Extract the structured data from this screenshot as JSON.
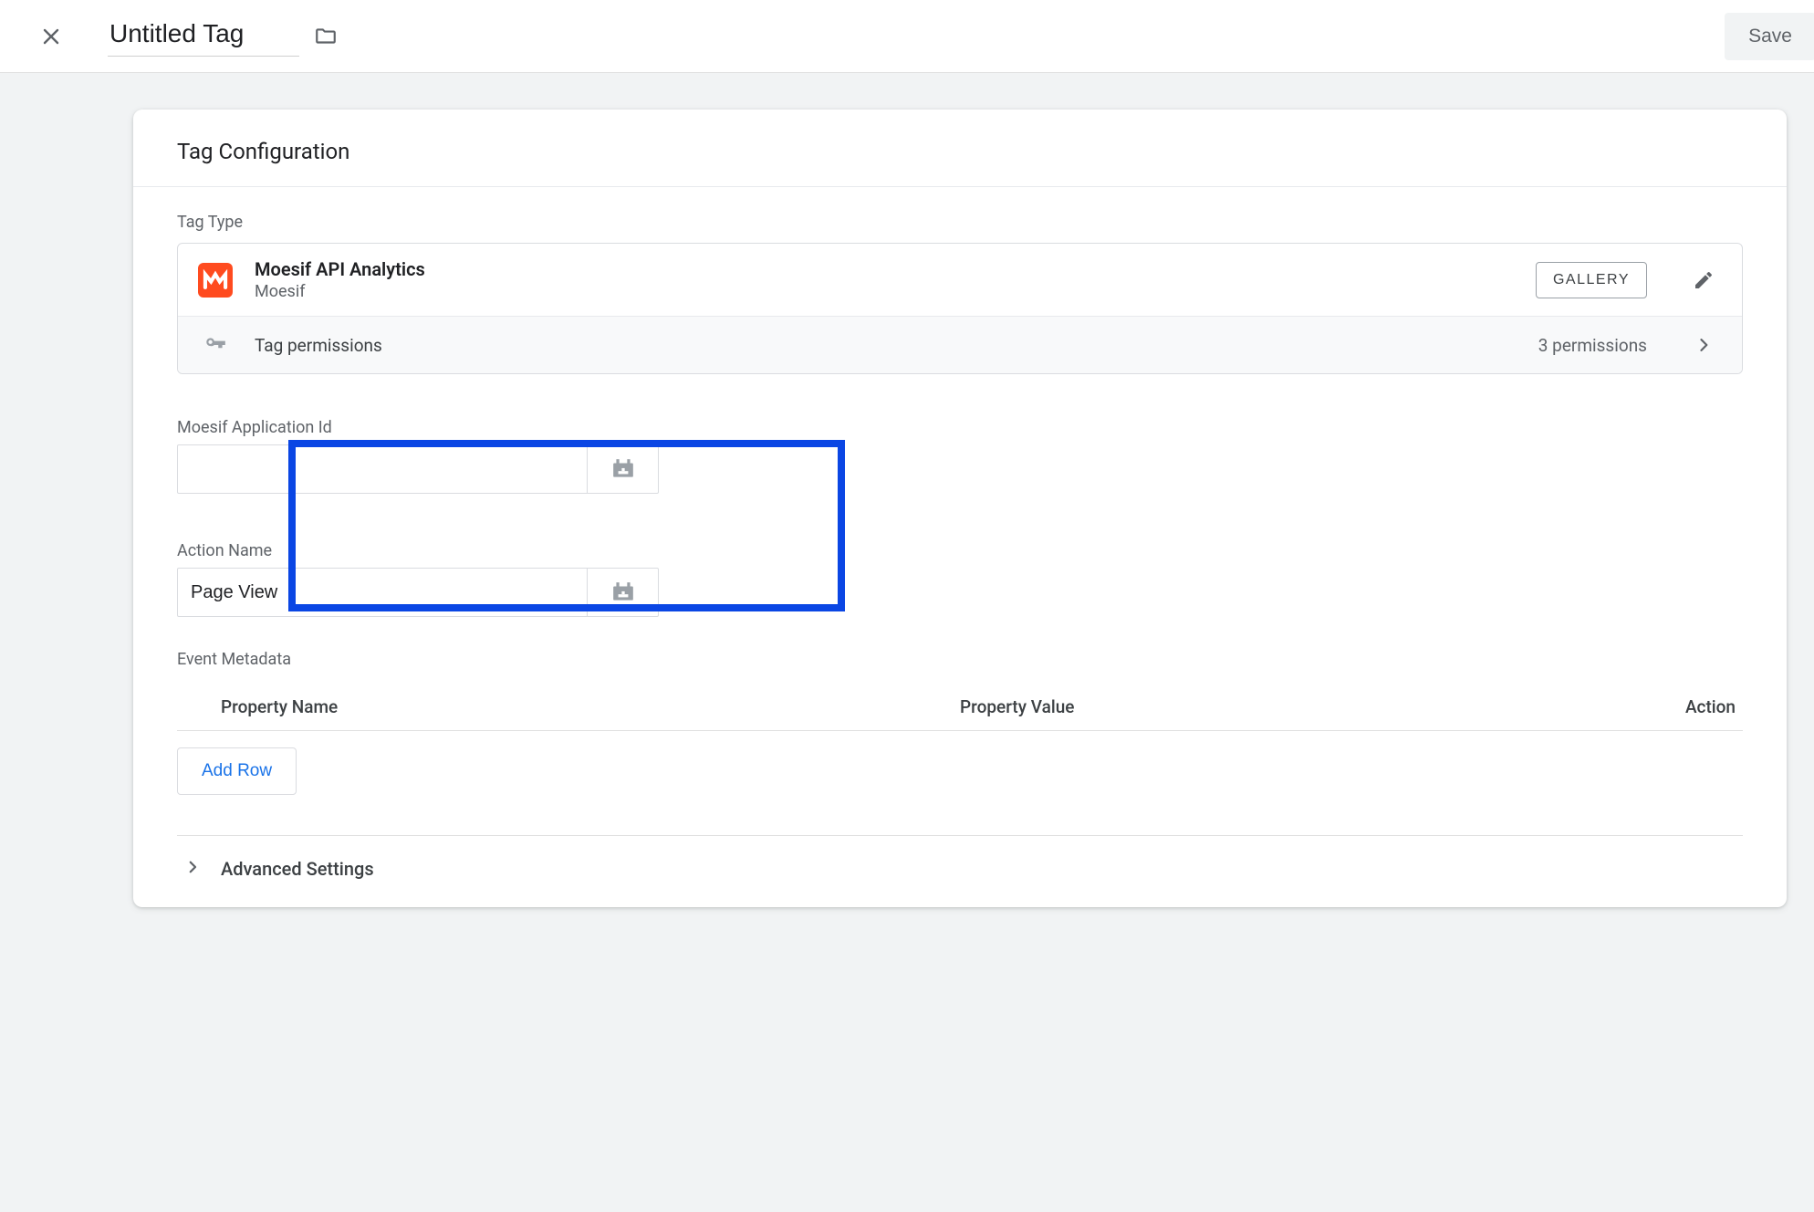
{
  "topbar": {
    "title": "Untitled Tag",
    "save_label": "Save"
  },
  "card": {
    "header": "Tag Configuration",
    "tag_type_label": "Tag Type",
    "tag": {
      "title": "Moesif API Analytics",
      "vendor": "Moesif",
      "gallery_button": "GALLERY"
    },
    "permissions": {
      "label": "Tag permissions",
      "count_text": "3 permissions"
    },
    "fields": {
      "app_id": {
        "label": "Moesif Application Id",
        "value": ""
      },
      "action_name": {
        "label": "Action Name",
        "value": "Page View"
      }
    },
    "metadata": {
      "section_label": "Event Metadata",
      "col_name": "Property Name",
      "col_value": "Property Value",
      "col_action": "Action",
      "add_row_label": "Add Row"
    },
    "advanced_label": "Advanced Settings"
  }
}
